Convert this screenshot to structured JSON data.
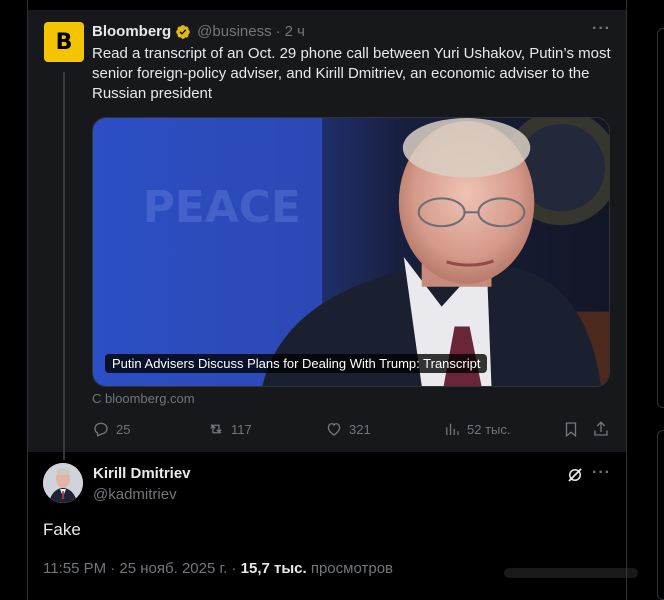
{
  "quoted_tweet": {
    "logo_letter": "B",
    "author_name": "Bloomberg",
    "handle": "@business",
    "separator": "·",
    "time": "2 ч",
    "text": "Read a transcript of an Oct. 29 phone call between Yuri Ushakov, Putin’s most senior foreign-policy adviser, and Kirill Dmitriev, an economic adviser to the Russian president",
    "card": {
      "background_text": "PEACE",
      "title": "Putin Advisers Discuss Plans for Dealing With Trump: Transcript",
      "source": "С bloomberg.com"
    },
    "stats": {
      "replies": "25",
      "reposts": "117",
      "likes": "321",
      "views": "52 тыс."
    }
  },
  "reply_tweet": {
    "author_name": "Kirill Dmitriev",
    "handle": "@kadmitriev",
    "text": "Fake",
    "time_date": "11:55 PM · 25 нояб. 2025 г. ·",
    "views_count": "15,7 тыс.",
    "views_label": "просмотров"
  },
  "colors": {
    "background": "#000000",
    "card_background": "#16181c",
    "text_primary": "#e7e9ea",
    "text_secondary": "#71767b",
    "bloomberg_yellow": "#f5c400",
    "verified_gold": "#e2b719"
  }
}
